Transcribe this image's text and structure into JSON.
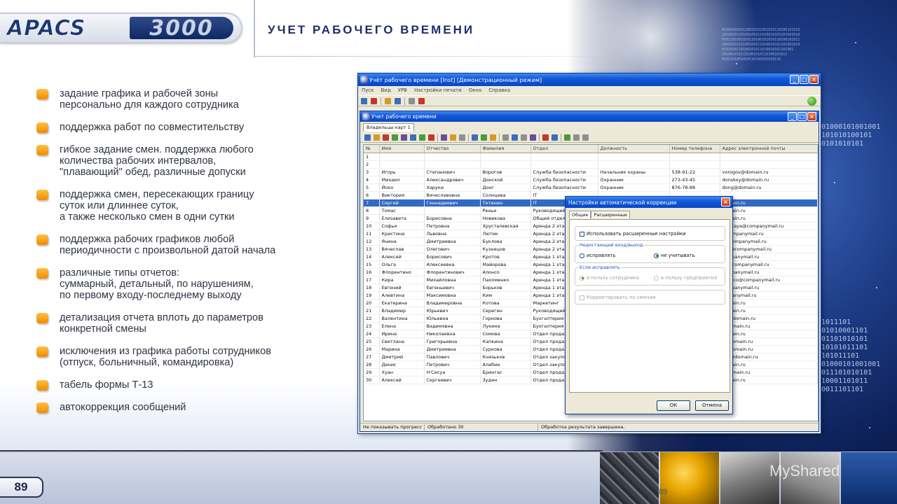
{
  "header": {
    "logo_left": "APACS",
    "logo_right": "3000",
    "title": "УЧЕТ РАБОЧЕГО ВРЕМЕНИ"
  },
  "bullets": [
    "задание графика и рабочей зоны\nперсонально для каждого сотрудника",
    "поддержка работ по совместительству",
    "гибкое задание смен. поддержка любого\nколичества рабочих интервалов,\n\"плавающий\" обед, различные допуски",
    "поддержка смен, пересекающих границу\nсуток или длиннее суток,\nа также несколько смен в одни сутки",
    "поддержка рабочих графиков любой\nпериодичности с произвольной датой начала",
    "различные типы отчетов:\nсуммарный, детальный, по нарушениям,\nпо первому входу-последнему выходу",
    "детализация отчета вплоть до параметров\nконкретной смены",
    "исключения из графика работы сотрудников\n(отпуск, больничный, командировка)",
    "табель формы Т-13",
    "автокоррекция сообщений"
  ],
  "footer": {
    "page_number": "89",
    "page_number_small": "89",
    "watermark": "MyShared"
  },
  "app_window": {
    "title": "Учёт рабочего времени [Inst] [Демонстрационный режим]",
    "menu": [
      "Пуск",
      "Вид",
      "УРВ",
      "Настройки печати",
      "Окно",
      "Справка"
    ],
    "child_title": "Учет рабочего времени",
    "tab": "Владельцы карт 1",
    "columns": [
      "№",
      "Имя",
      "Отчество",
      "Фамилия",
      "Отдел",
      "Должность",
      "Номер телефона",
      "Адрес электронной почты"
    ],
    "rows": [
      [
        "1",
        "",
        "",
        "",
        "",
        "",
        "",
        ""
      ],
      [
        "2",
        "",
        "",
        "",
        "",
        "",
        "",
        ""
      ],
      [
        "3",
        "Игорь",
        "Степанович",
        "Ворогов",
        "Служба безопасности",
        "Начальник охраны",
        "538-91-22",
        "vorogov@domain.ru"
      ],
      [
        "4",
        "Михаил",
        "Александрович",
        "Донской",
        "Служба безопасности",
        "Охранник",
        "273-43-45",
        "donskoy@domain.ru"
      ],
      [
        "5",
        "Йоко",
        "Харуки",
        "Донг",
        "Служба безопасности",
        "Охранник",
        "876-78-88",
        "dong@domain.ru"
      ],
      [
        "6",
        "Виктория",
        "Вячеславовна",
        "Солнцева",
        "IT",
        "",
        "",
        ""
      ],
      [
        "7",
        "Сергей",
        "Геннадиевич",
        "Тетинин",
        "IT",
        "",
        "",
        "domain.ru"
      ],
      [
        "8",
        "Томас",
        "",
        "Ренье",
        "Руководящий отдел",
        "",
        "",
        "domain.ru"
      ],
      [
        "9",
        "Елизавета",
        "Борисовна",
        "Новикова",
        "Общий отдел",
        "",
        "",
        "domain.ru"
      ],
      [
        "10",
        "Софья",
        "Петровна",
        "Хрусталевская",
        "Аренда 2 этаж",
        "",
        "",
        "levskaya@companymail.ru"
      ],
      [
        "11",
        "Кристина",
        "Львовна",
        "Лютик",
        "Аренда 2 этаж",
        "",
        "",
        "@companymail.ru"
      ],
      [
        "12",
        "Янина",
        "Дмитриевна",
        "Буклова",
        "Аренда 2 этаж",
        "",
        "",
        "a@companymail.ru"
      ],
      [
        "13",
        "Вячеслав",
        "Олегович",
        "Кузнецов",
        "Аренда 2 этаж",
        "",
        "",
        "zov@companymail.ru"
      ],
      [
        "14",
        "Алексей",
        "Борисович",
        "Кротов",
        "Аренда 1 этаж",
        "",
        "",
        "companymail.ru"
      ],
      [
        "15",
        "Ольга",
        "Алексеевна",
        "Майорова",
        "Аренда 1 этаж",
        "",
        "",
        "va@companymail.ru"
      ],
      [
        "16",
        "Флорентино",
        "Флорентинович",
        "Алонсо",
        "Аренда 1 этаж",
        "",
        "",
        "companymail.ru"
      ],
      [
        "17",
        "Кира",
        "Михайловна",
        "Пахоменко",
        "Аренда 1 этаж",
        "",
        "",
        "chenco@companymail.ru"
      ],
      [
        "18",
        "Евгений",
        "Евгеньевич",
        "Борьков",
        "Аренда 1 этаж",
        "",
        "",
        "companymail.ru"
      ],
      [
        "19",
        "Алевтина",
        "Максимовна",
        "Ким",
        "Аренда 1 этаж",
        "",
        "",
        "ompanymail.ru"
      ],
      [
        "20",
        "Екатерина",
        "Владимировна",
        "Котова",
        "Маркетинг",
        "",
        "",
        "domain.ru"
      ],
      [
        "21",
        "Владимир",
        "Юрьевич",
        "Серегин",
        "Руководящий отдел",
        "",
        "",
        "domain.ru"
      ],
      [
        "22",
        "Валентина",
        "Юльевна",
        "Горнова",
        "Бухгалтерия",
        "",
        "",
        "va@domain.ru"
      ],
      [
        "23",
        "Елена",
        "Вадимовна",
        "Лукина",
        "Бухгалтерия",
        "",
        "",
        "@domain.ru"
      ],
      [
        "24",
        "Ирина",
        "Николаевна",
        "Сомова",
        "Отдел продаж",
        "",
        "",
        "domain.ru"
      ],
      [
        "25",
        "Светлана",
        "Григорьевна",
        "Капкина",
        "Отдел продаж",
        "",
        "",
        "a@domain.ru"
      ],
      [
        "26",
        "Марина",
        "Дмитриевна",
        "Суркова",
        "Отдел продаж",
        "",
        "",
        "a@domain.ru"
      ],
      [
        "27",
        "Дмитрий",
        "Павлович",
        "Князьков",
        "Отдел закупок",
        "",
        "",
        "cov@domain.ru"
      ],
      [
        "28",
        "Денис",
        "Петрович",
        "Алабин",
        "Отдел закупок",
        "",
        "",
        "domain.ru"
      ],
      [
        "29",
        "Хуан",
        "Н'Сисуа",
        "Брингас",
        "Отдел продаж",
        "",
        "",
        "@domain.ru"
      ],
      [
        "30",
        "Алексей",
        "Сергеевич",
        "Зудин",
        "Отдел продаж",
        "",
        "",
        "domain.ru"
      ]
    ],
    "selected_row": 6,
    "status": [
      "Не показывать прогресс",
      "Обработано 30",
      "Обработка результата завершена."
    ]
  },
  "dialog": {
    "title": "Настройки автоматической коррекции",
    "tabs": [
      "Общие",
      "Расширенные"
    ],
    "use_ext_label": "Использовать расширенные настройки",
    "missing_group": "Недостающий вход/выход",
    "opt_fix": "исправлять",
    "opt_ignore": "не учитывать",
    "if_fix_group": "Если исправлять",
    "opt_employee": "в пользу сотрудника",
    "opt_company": "в пользу предприятия",
    "correct_by_shift": "Корректировать по сменам",
    "ok": "ОК",
    "cancel": "Отмена"
  },
  "colors": {
    "accent_orange": "#f5a623",
    "title_blue": "#1c3068",
    "xp_title": "#0a46c7",
    "selection": "#316ac5"
  }
}
